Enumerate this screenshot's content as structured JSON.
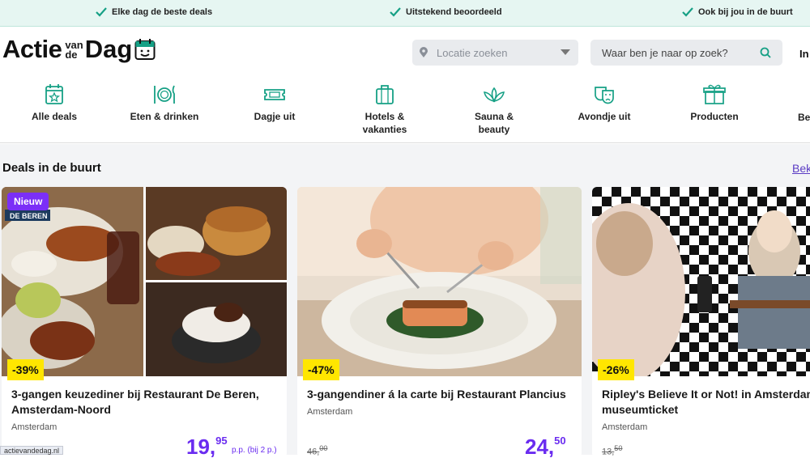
{
  "usps": [
    "Elke dag de beste deals",
    "Uitstekend beoordeeld",
    "Ook bij jou in de buurt"
  ],
  "logo": {
    "part1": "Actie",
    "small1": "van",
    "small2": "de",
    "part2": "Dag"
  },
  "location": {
    "placeholder": "Locatie zoeken"
  },
  "search": {
    "placeholder": "Waar ben je naar op zoek?"
  },
  "login_partial": "In",
  "categories": [
    {
      "label": "Alle deals",
      "icon": "calendar-star-icon"
    },
    {
      "label": "Eten & drinken",
      "icon": "plate-cutlery-icon"
    },
    {
      "label": "Dagje uit",
      "icon": "ticket-icon"
    },
    {
      "label": "Hotels & vakanties",
      "icon": "suitcase-icon"
    },
    {
      "label": "Sauna & beauty",
      "icon": "lotus-icon"
    },
    {
      "label": "Avondje uit",
      "icon": "theater-masks-icon"
    },
    {
      "label": "Producten",
      "icon": "gift-box-icon"
    },
    {
      "label": "Be",
      "icon": "partial-category-icon"
    }
  ],
  "section": {
    "title": "Deals in de buurt",
    "see_all": "Bek"
  },
  "deals": [
    {
      "badge": "Nieuw",
      "discount": "-39%",
      "title": "3-gangen keuzediner bij Restaurant De Beren, Amsterdam-Noord",
      "location": "Amsterdam",
      "old_price": "",
      "price_main": "19,",
      "price_cents": "95",
      "price_note": "p.p. (bij 2 p.)",
      "image_text": "DE BEREN"
    },
    {
      "badge": "",
      "discount": "-47%",
      "title": "3-gangendiner á la carte bij Restaurant Plancius",
      "location": "Amsterdam",
      "old_price": "46,",
      "old_cents": "00",
      "price_main": "24,",
      "price_cents": "50",
      "price_note": ""
    },
    {
      "badge": "",
      "discount": "-26%",
      "title": "Ripley's Believe It or Not! in Amsterdam museumticket",
      "location": "Amsterdam",
      "old_price": "13,",
      "old_cents": "50",
      "price_main": "",
      "price_cents": "",
      "price_note": ""
    }
  ],
  "status_url": "actievandedag.nl",
  "colors": {
    "accent": "#6a2cf0",
    "discount": "#ffe600",
    "usp_bg": "#e6f6f2",
    "teal": "#16a085"
  }
}
